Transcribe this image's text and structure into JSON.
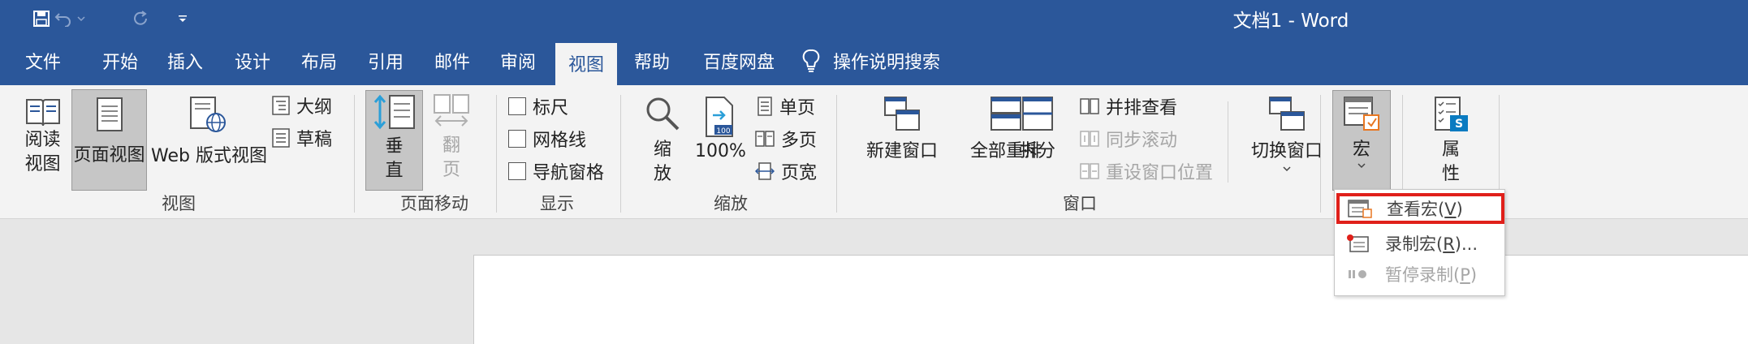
{
  "window": {
    "title": "文档1  -  Word"
  },
  "qat": {
    "save": "save-icon",
    "undo": "undo-icon",
    "redo": "redo-icon",
    "customize": "customize-icon"
  },
  "tabs": [
    {
      "label": "文件"
    },
    {
      "label": "开始"
    },
    {
      "label": "插入"
    },
    {
      "label": "设计"
    },
    {
      "label": "布局"
    },
    {
      "label": "引用"
    },
    {
      "label": "邮件"
    },
    {
      "label": "审阅"
    },
    {
      "label": "视图"
    },
    {
      "label": "帮助"
    },
    {
      "label": "百度网盘"
    }
  ],
  "tell_me": {
    "label": "操作说明搜索"
  },
  "ribbon": {
    "views": {
      "read_mode_1": "阅读",
      "read_mode_2": "视图",
      "print_layout": "页面视图",
      "web_layout": "Web 版式视图",
      "outline": "大纲",
      "draft": "草稿",
      "group": "视图"
    },
    "page_movement": {
      "vertical_1": "垂",
      "vertical_2": "直",
      "side_1": "翻",
      "side_2": "页",
      "group": "页面移动"
    },
    "show": {
      "ruler": "标尺",
      "gridlines": "网格线",
      "nav_pane": "导航窗格",
      "group": "显示"
    },
    "zoom": {
      "zoom_1": "缩",
      "zoom_2": "放",
      "hundred": "100%",
      "one_page": "单页",
      "multi_page": "多页",
      "page_width": "页宽",
      "group": "缩放"
    },
    "window": {
      "new_window": "新建窗口",
      "arrange_all": "全部重排",
      "split": "拆分",
      "side_by_side": "并排查看",
      "sync_scroll": "同步滚动",
      "reset_position": "重设窗口位置",
      "switch_windows": "切换窗口",
      "group": "窗口"
    },
    "macros": {
      "label": "宏"
    },
    "properties": {
      "label_1": "属",
      "label_2": "性"
    }
  },
  "macro_menu": {
    "view_macros": {
      "prefix": "查看宏(",
      "key": "V",
      "suffix": ")"
    },
    "record_macro": {
      "prefix": "录制宏(",
      "key": "R",
      "suffix": ")..."
    },
    "pause_recording": {
      "prefix": "暂停录制(",
      "key": "P",
      "suffix": ")"
    }
  },
  "colors": {
    "accent": "#2b579a",
    "highlight": "#e0201a",
    "pressed": "#c6c6c6"
  }
}
